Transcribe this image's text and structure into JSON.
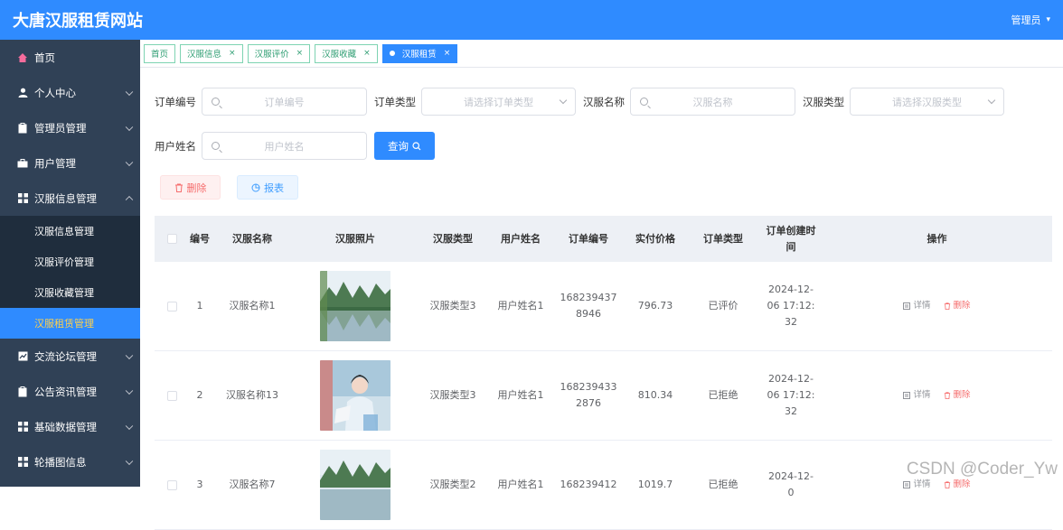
{
  "header": {
    "title": "大唐汉服租赁网站",
    "user": "管理员"
  },
  "sidebar": {
    "items": [
      {
        "label": "首页",
        "icon": "home-icon",
        "expandable": false
      },
      {
        "label": "个人中心",
        "icon": "person-icon",
        "expandable": true
      },
      {
        "label": "管理员管理",
        "icon": "clipboard-icon",
        "expandable": true
      },
      {
        "label": "用户管理",
        "icon": "briefcase-icon",
        "expandable": true
      },
      {
        "label": "汉服信息管理",
        "icon": "grid-icon",
        "expandable": true,
        "children": [
          "汉服信息管理",
          "汉服评价管理",
          "汉服收藏管理",
          "汉服租赁管理"
        ],
        "active_child": 3
      },
      {
        "label": "交流论坛管理",
        "icon": "chart-icon",
        "expandable": true
      },
      {
        "label": "公告资讯管理",
        "icon": "clipboard-icon",
        "expandable": true
      },
      {
        "label": "基础数据管理",
        "icon": "grid-icon",
        "expandable": true
      },
      {
        "label": "轮播图信息",
        "icon": "grid-icon",
        "expandable": true
      }
    ]
  },
  "tabs": [
    {
      "label": "首页",
      "closable": false,
      "active": false
    },
    {
      "label": "汉服信息",
      "closable": true,
      "active": false
    },
    {
      "label": "汉服评价",
      "closable": true,
      "active": false
    },
    {
      "label": "汉服收藏",
      "closable": true,
      "active": false
    },
    {
      "label": "汉服租赁",
      "closable": true,
      "active": true
    }
  ],
  "search": {
    "order_no_label": "订单编号",
    "order_no_placeholder": "订单编号",
    "order_type_label": "订单类型",
    "order_type_placeholder": "请选择订单类型",
    "hanfu_name_label": "汉服名称",
    "hanfu_name_placeholder": "汉服名称",
    "hanfu_type_label": "汉服类型",
    "hanfu_type_placeholder": "请选择汉服类型",
    "user_name_label": "用户姓名",
    "user_name_placeholder": "用户姓名",
    "query_label": "查询"
  },
  "actions": {
    "delete_label": "删除",
    "report_label": "报表"
  },
  "table": {
    "columns": [
      "编号",
      "汉服名称",
      "汉服照片",
      "汉服类型",
      "用户姓名",
      "订单编号",
      "实付价格",
      "订单类型",
      "订单创建时间",
      "操作"
    ],
    "rows": [
      {
        "id": "1",
        "name": "汉服名称1",
        "photo": "landscape",
        "type": "汉服类型3",
        "user": "用户姓名1",
        "order_no": "1682394378946",
        "price": "796.73",
        "order_type": "已评价",
        "created": "2024-12-06 17:12:32"
      },
      {
        "id": "2",
        "name": "汉服名称13",
        "photo": "portrait",
        "type": "汉服类型3",
        "user": "用户姓名1",
        "order_no": "1682394332876",
        "price": "810.34",
        "order_type": "已拒绝",
        "created": "2024-12-06 17:12:32"
      },
      {
        "id": "3",
        "name": "汉服名称7",
        "photo": "landscape",
        "type": "汉服类型2",
        "user": "用户姓名1",
        "order_no": "168239412",
        "price": "1019.7",
        "order_type": "已拒绝",
        "created": "2024-12-0"
      }
    ],
    "op_detail": "详情",
    "op_delete": "删除"
  },
  "watermark": "CSDN @Coder_Yw"
}
